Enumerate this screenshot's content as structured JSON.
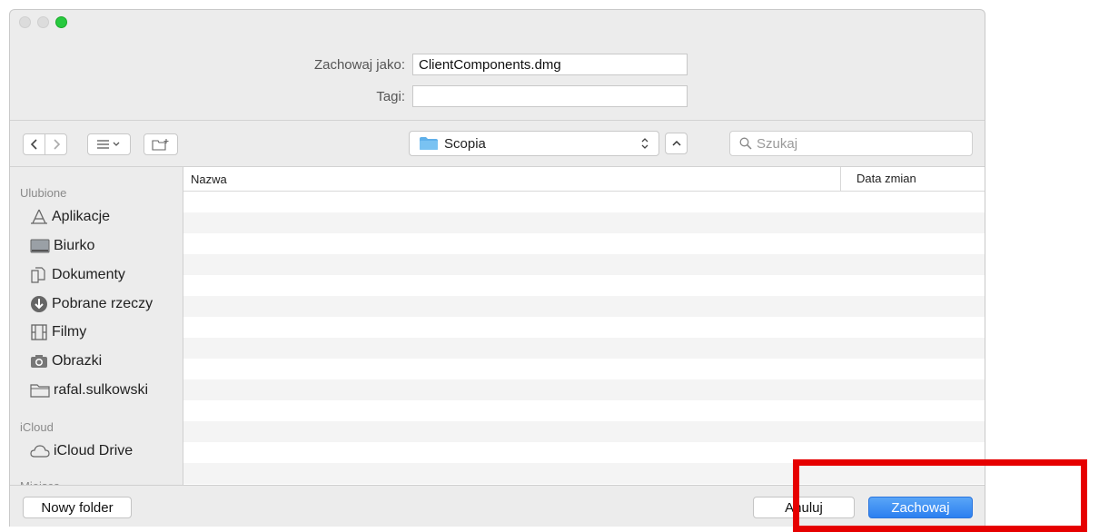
{
  "dialog": {
    "save_as_label": "Zachowaj jako:",
    "save_as_value": "ClientComponents.dmg",
    "tags_label": "Tagi:",
    "tags_value": ""
  },
  "toolbar": {
    "location": "Scopia",
    "search_placeholder": "Szukaj"
  },
  "sidebar": {
    "favorites_header": "Ulubione",
    "favorites": [
      {
        "label": "Aplikacje",
        "icon": "applications-icon"
      },
      {
        "label": "Biurko",
        "icon": "desktop-icon"
      },
      {
        "label": "Dokumenty",
        "icon": "documents-icon"
      },
      {
        "label": "Pobrane rzeczy",
        "icon": "downloads-icon"
      },
      {
        "label": "Filmy",
        "icon": "movies-icon"
      },
      {
        "label": "Obrazki",
        "icon": "pictures-icon"
      },
      {
        "label": "rafal.sulkowski",
        "icon": "home-folder-icon"
      }
    ],
    "icloud_header": "iCloud",
    "icloud": [
      {
        "label": "iCloud Drive",
        "icon": "cloud-icon"
      }
    ],
    "places_header": "Miejsca"
  },
  "file_list": {
    "columns": [
      "Nazwa",
      "Data zmian"
    ]
  },
  "buttons": {
    "new_folder": "Nowy folder",
    "cancel": "Anuluj",
    "save": "Zachowaj"
  },
  "colors": {
    "accent": "#2c7ff0",
    "highlight": "#e60000",
    "traffic_green": "#27c93f"
  }
}
